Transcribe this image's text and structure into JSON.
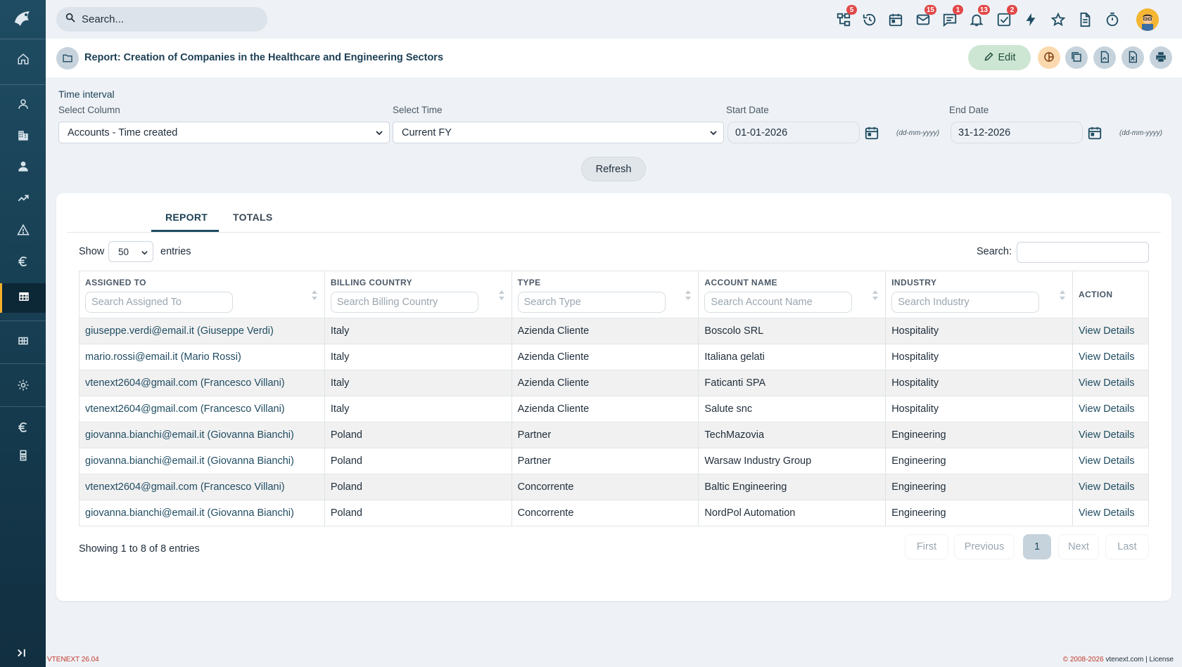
{
  "topbar": {
    "search_placeholder": "Search...",
    "badges": {
      "processes": "5",
      "mail": "15",
      "chat": "1",
      "notifications": "13",
      "tasks": "2"
    }
  },
  "header": {
    "title": "Report: Creation of Companies in the Healthcare and Engineering Sectors",
    "edit_label": "Edit"
  },
  "filters": {
    "section_label": "Time interval",
    "select_column_label": "Select Column",
    "select_column_value": "Accounts - Time created",
    "select_time_label": "Select Time",
    "select_time_value": "Current FY",
    "start_date_label": "Start Date",
    "start_date_value": "01-01-2026",
    "end_date_label": "End Date",
    "end_date_value": "31-12-2026",
    "date_format": "(dd-mm-yyyy)",
    "refresh_label": "Refresh"
  },
  "tabs": [
    "REPORT",
    "TOTALS"
  ],
  "table": {
    "show_label": "Show",
    "page_size": "50",
    "entries_label": "entries",
    "search_label": "Search:",
    "columns": [
      {
        "header": "ASSIGNED TO",
        "placeholder": "Search Assigned To"
      },
      {
        "header": "BILLING COUNTRY",
        "placeholder": "Search Billing Country"
      },
      {
        "header": "TYPE",
        "placeholder": "Search Type"
      },
      {
        "header": "ACCOUNT NAME",
        "placeholder": "Search Account Name"
      },
      {
        "header": "INDUSTRY",
        "placeholder": "Search Industry"
      },
      {
        "header": "ACTION",
        "placeholder": ""
      }
    ],
    "rows": [
      {
        "assigned": "giuseppe.verdi@email.it (Giuseppe Verdi)",
        "country": "Italy",
        "type": "Azienda Cliente",
        "account": "Boscolo SRL",
        "industry": "Hospitality",
        "action": "View Details"
      },
      {
        "assigned": "mario.rossi@email.it (Mario Rossi)",
        "country": "Italy",
        "type": "Azienda Cliente",
        "account": "Italiana gelati",
        "industry": "Hospitality",
        "action": "View Details"
      },
      {
        "assigned": "vtenext2604@gmail.com (Francesco Villani)",
        "country": "Italy",
        "type": "Azienda Cliente",
        "account": "Faticanti SPA",
        "industry": "Hospitality",
        "action": "View Details"
      },
      {
        "assigned": "vtenext2604@gmail.com (Francesco Villani)",
        "country": "Italy",
        "type": "Azienda Cliente",
        "account": "Salute snc",
        "industry": "Hospitality",
        "action": "View Details"
      },
      {
        "assigned": "giovanna.bianchi@email.it (Giovanna Bianchi)",
        "country": "Poland",
        "type": "Partner",
        "account": "TechMazovia",
        "industry": "Engineering",
        "action": "View Details"
      },
      {
        "assigned": "giovanna.bianchi@email.it (Giovanna Bianchi)",
        "country": "Poland",
        "type": "Partner",
        "account": "Warsaw Industry Group",
        "industry": "Engineering",
        "action": "View Details"
      },
      {
        "assigned": "vtenext2604@gmail.com (Francesco Villani)",
        "country": "Poland",
        "type": "Concorrente",
        "account": "Baltic Engineering",
        "industry": "Engineering",
        "action": "View Details"
      },
      {
        "assigned": "giovanna.bianchi@email.it (Giovanna Bianchi)",
        "country": "Poland",
        "type": "Concorrente",
        "account": "NordPol Automation",
        "industry": "Engineering",
        "action": "View Details"
      }
    ],
    "info": "Showing 1 to 8 of 8 entries",
    "pagination": {
      "first": "First",
      "previous": "Previous",
      "current": "1",
      "next": "Next",
      "last": "Last"
    }
  },
  "footer": {
    "version": "VTENEXT 26.04",
    "copyright": "© 2008-2026",
    "site": "vtenext.com",
    "license": "License"
  }
}
